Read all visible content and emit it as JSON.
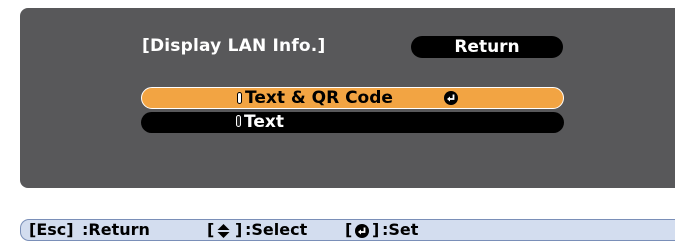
{
  "menu": {
    "title": "[Display LAN Info.]",
    "return_label": "Return",
    "options": [
      {
        "label": "Text & QR Code",
        "selected": true,
        "has_enter_icon": true
      },
      {
        "label": "Text",
        "selected": false
      }
    ]
  },
  "help": {
    "esc_key": "[Esc]",
    "esc_action": ":Return",
    "select_open": "[",
    "select_close": "]",
    "select_action": ":Select",
    "set_open": "[",
    "set_close": "]",
    "set_action": ":Set"
  },
  "colors": {
    "panel": "#58585a",
    "selected_option": "#f2a443",
    "option": "#000000",
    "help_bar": "#d3ddef"
  },
  "icons": [
    "up-down-arrow-icon",
    "enter-icon"
  ]
}
